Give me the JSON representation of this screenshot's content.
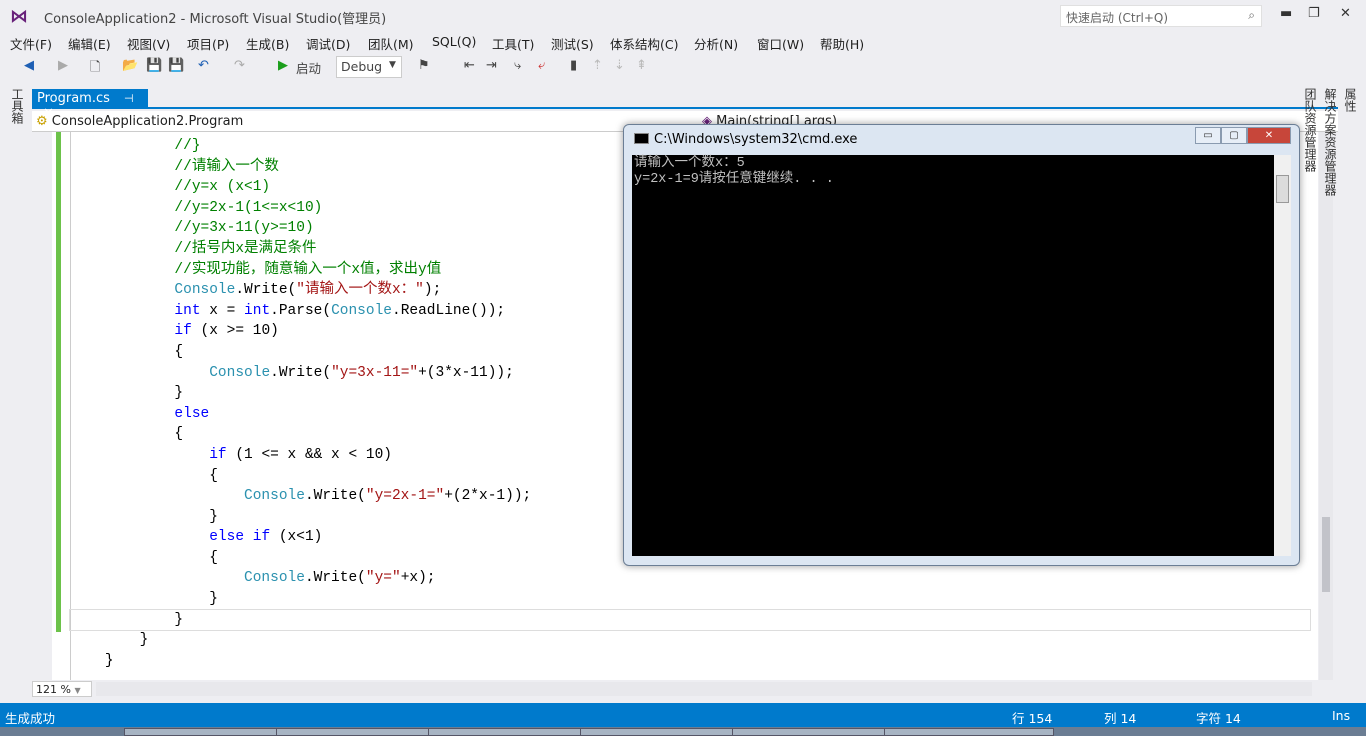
{
  "window": {
    "title": "ConsoleApplication2 - Microsoft Visual Studio(管理员)",
    "quick_launch_placeholder": "快速启动 (Ctrl+Q)"
  },
  "menu": [
    "文件(F)",
    "编辑(E)",
    "视图(V)",
    "项目(P)",
    "生成(B)",
    "调试(D)",
    "团队(M)",
    "SQL(Q)",
    "工具(T)",
    "测试(S)",
    "体系结构(C)",
    "分析(N)",
    "窗口(W)",
    "帮助(H)"
  ],
  "toolbar": {
    "start_label": "启动",
    "config": "Debug"
  },
  "left_panel": "工具箱",
  "right_panels": [
    "属性",
    "解决方案资源管理器",
    "团队资源管理器"
  ],
  "tab": {
    "label": "Program.cs"
  },
  "nav": {
    "class": "ConsoleApplication2.Program",
    "member": "Main(string[] args)"
  },
  "code": [
    {
      "indent": 12,
      "seg": [
        [
          "c",
          "//}"
        ]
      ]
    },
    {
      "indent": 12,
      "seg": [
        [
          "c",
          "//请输入一个数"
        ]
      ]
    },
    {
      "indent": 12,
      "seg": [
        [
          "c",
          "//y=x (x<1)"
        ]
      ]
    },
    {
      "indent": 12,
      "seg": [
        [
          "c",
          "//y=2x-1(1<=x<10)"
        ]
      ]
    },
    {
      "indent": 12,
      "seg": [
        [
          "c",
          "//y=3x-11(y>=10)"
        ]
      ]
    },
    {
      "indent": 12,
      "seg": [
        [
          "c",
          "//括号内x是满足条件"
        ]
      ]
    },
    {
      "indent": 12,
      "seg": [
        [
          "c",
          "//实现功能，随意输入一个x值，求出y值"
        ]
      ]
    },
    {
      "indent": 12,
      "seg": [
        [
          "t",
          "Console"
        ],
        [
          "p",
          ".Write("
        ],
        [
          "s",
          "\"请输入一个数x：\""
        ],
        [
          "p",
          ");"
        ]
      ]
    },
    {
      "indent": 12,
      "seg": [
        [
          "k",
          "int"
        ],
        [
          "p",
          " x = "
        ],
        [
          "k",
          "int"
        ],
        [
          "p",
          ".Parse("
        ],
        [
          "t",
          "Console"
        ],
        [
          "p",
          ".ReadLine());"
        ]
      ]
    },
    {
      "indent": 12,
      "seg": [
        [
          "k",
          "if"
        ],
        [
          "p",
          " (x >= 10)"
        ]
      ]
    },
    {
      "indent": 12,
      "seg": [
        [
          "p",
          "{"
        ]
      ]
    },
    {
      "indent": 16,
      "seg": [
        [
          "t",
          "Console"
        ],
        [
          "p",
          ".Write("
        ],
        [
          "s",
          "\"y=3x-11=\""
        ],
        [
          "p",
          "+(3*x-11));"
        ]
      ]
    },
    {
      "indent": 12,
      "seg": [
        [
          "p",
          "}"
        ]
      ]
    },
    {
      "indent": 12,
      "seg": [
        [
          "k",
          "else"
        ]
      ]
    },
    {
      "indent": 12,
      "seg": [
        [
          "p",
          "{"
        ]
      ]
    },
    {
      "indent": 16,
      "seg": [
        [
          "k",
          "if"
        ],
        [
          "p",
          " (1 <= x && x < 10)"
        ]
      ]
    },
    {
      "indent": 16,
      "seg": [
        [
          "p",
          "{"
        ]
      ]
    },
    {
      "indent": 20,
      "seg": [
        [
          "t",
          "Console"
        ],
        [
          "p",
          ".Write("
        ],
        [
          "s",
          "\"y=2x-1=\""
        ],
        [
          "p",
          "+(2*x-1));"
        ]
      ]
    },
    {
      "indent": 16,
      "seg": [
        [
          "p",
          "}"
        ]
      ]
    },
    {
      "indent": 16,
      "seg": [
        [
          "k",
          "else if"
        ],
        [
          "p",
          " (x<1)"
        ]
      ]
    },
    {
      "indent": 16,
      "seg": [
        [
          "p",
          "{"
        ]
      ]
    },
    {
      "indent": 20,
      "seg": [
        [
          "t",
          "Console"
        ],
        [
          "p",
          ".Write("
        ],
        [
          "s",
          "\"y=\""
        ],
        [
          "p",
          "+x);"
        ]
      ]
    },
    {
      "indent": 16,
      "seg": [
        [
          "p",
          "}"
        ]
      ]
    },
    {
      "indent": 12,
      "seg": [
        [
          "p",
          "}"
        ]
      ],
      "current": true
    },
    {
      "indent": 8,
      "seg": [
        [
          "p",
          "}"
        ]
      ]
    },
    {
      "indent": 4,
      "seg": [
        [
          "p",
          "}"
        ]
      ]
    }
  ],
  "zoom": "121 %",
  "status": {
    "message": "生成成功",
    "line": "行 154",
    "col": "列 14",
    "char": "字符 14",
    "mode": "Ins"
  },
  "cmd": {
    "title": "C:\\Windows\\system32\\cmd.exe",
    "output": [
      "请输入一个数x：5",
      "y=2x-1=9请按任意键继续. . ."
    ]
  }
}
